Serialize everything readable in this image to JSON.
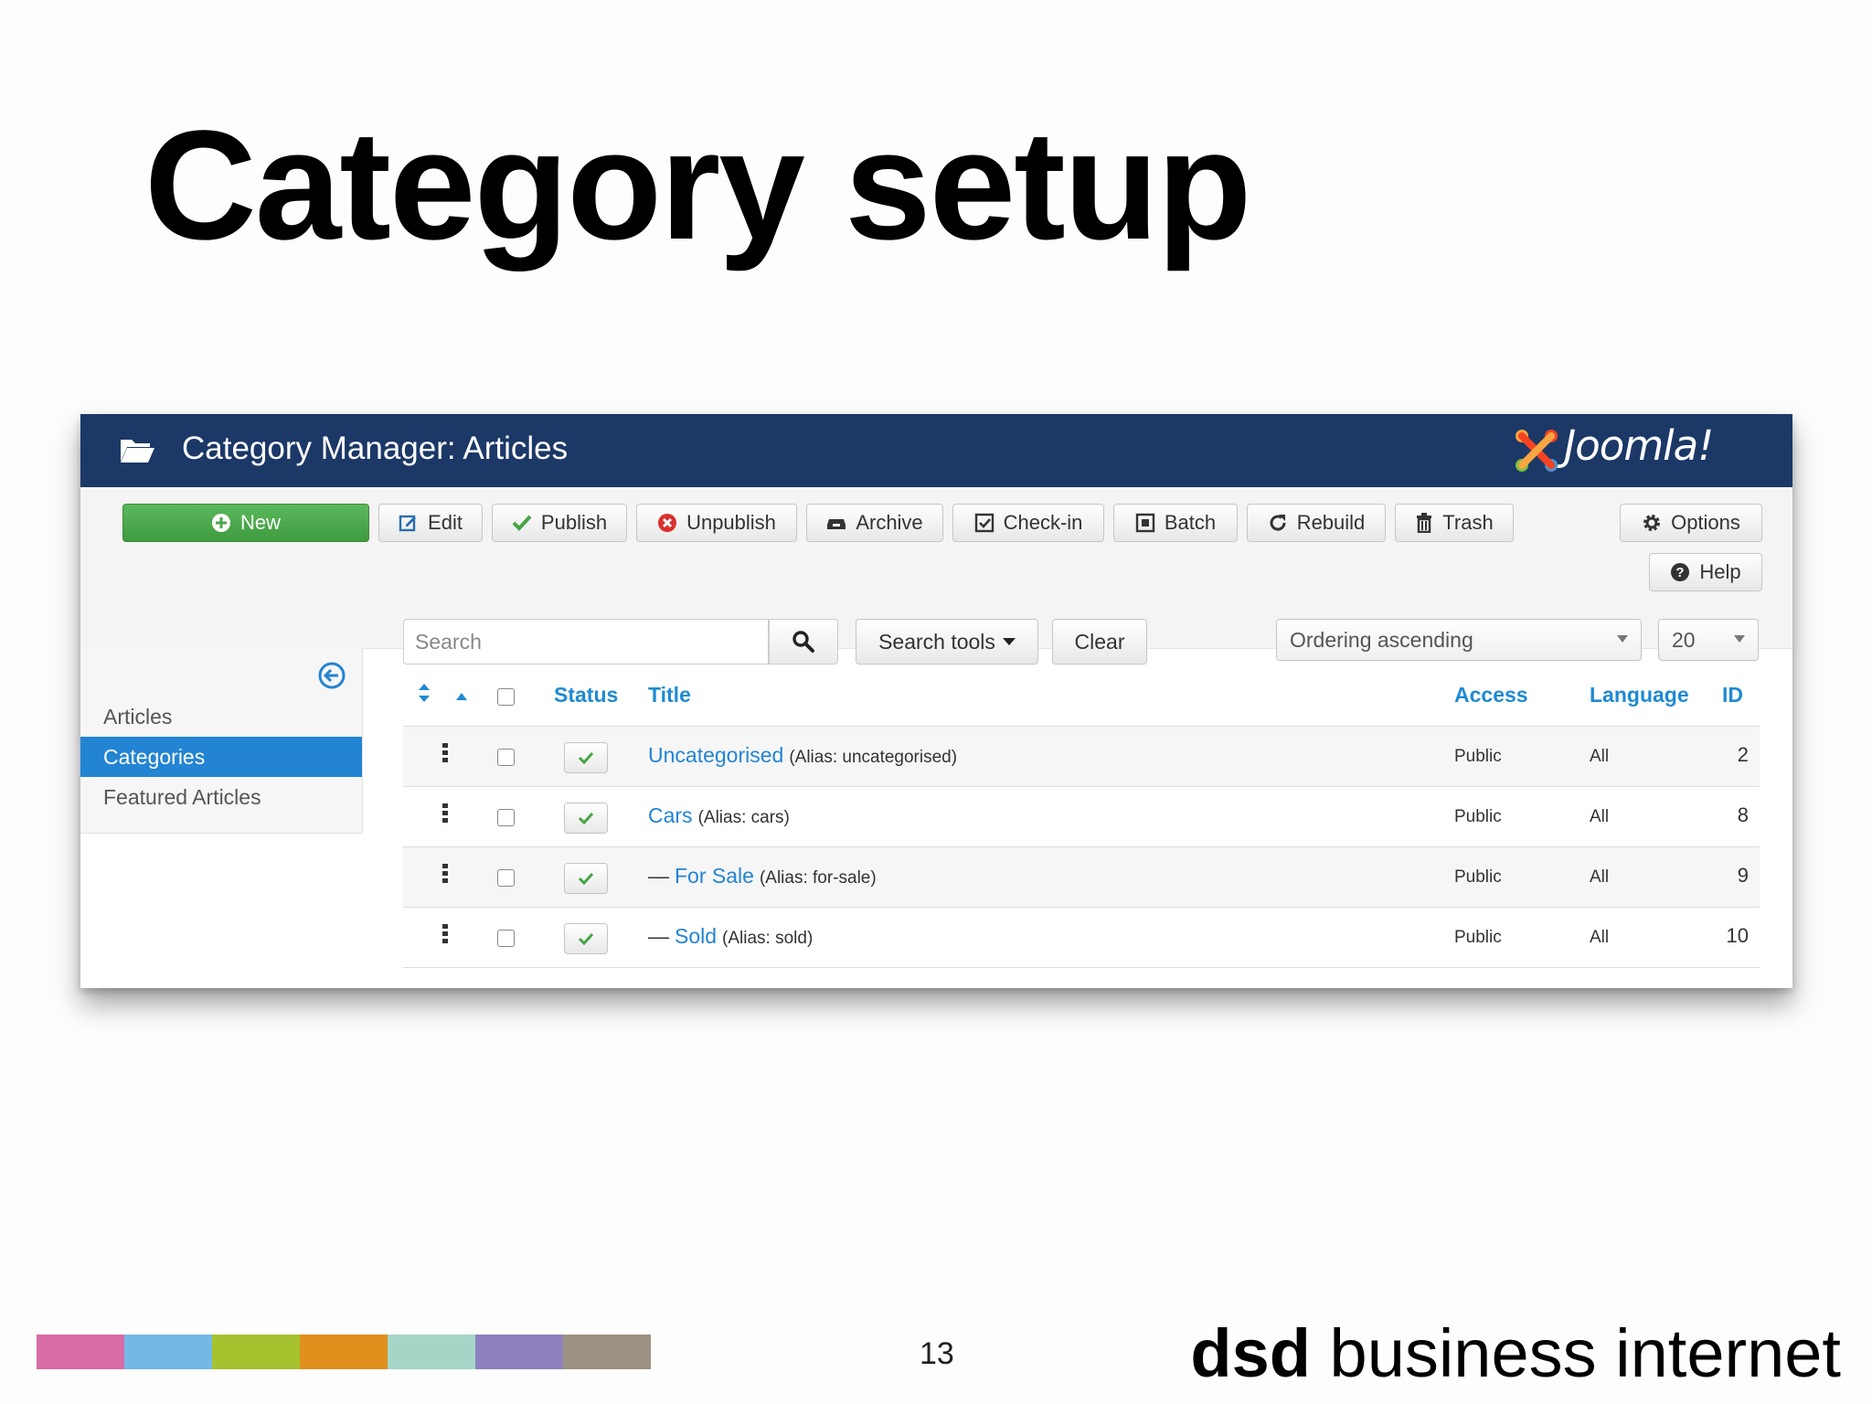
{
  "slide": {
    "title": "Category setup",
    "page_number": "13",
    "brand_bold": "dsd",
    "brand_rest": " business internet",
    "color_strip": [
      "#d86ca6",
      "#74b9e4",
      "#a6c22e",
      "#e08f1d",
      "#a5d5c6",
      "#8e80be",
      "#9c9282"
    ]
  },
  "app": {
    "header_title": "Category Manager: Articles",
    "logo_text": "Joomla!",
    "header_icon": "folder-open-icon",
    "header_bg": "#1b3867",
    "accent": "#2384d3"
  },
  "toolbar": {
    "new": "New",
    "edit": "Edit",
    "publish": "Publish",
    "unpublish": "Unpublish",
    "archive": "Archive",
    "checkin": "Check-in",
    "batch": "Batch",
    "rebuild": "Rebuild",
    "trash": "Trash",
    "options": "Options",
    "help": "Help"
  },
  "sidebar": {
    "items": [
      {
        "label": "Articles",
        "active": false
      },
      {
        "label": "Categories",
        "active": true
      },
      {
        "label": "Featured Articles",
        "active": false
      }
    ]
  },
  "filters": {
    "search_placeholder": "Search",
    "search_tools": "Search tools",
    "clear": "Clear",
    "ordering": "Ordering ascending",
    "limit": "20"
  },
  "table": {
    "columns": {
      "status": "Status",
      "title": "Title",
      "access": "Access",
      "language": "Language",
      "id": "ID"
    },
    "rows": [
      {
        "prefix": "",
        "title": "Uncategorised",
        "alias": "(Alias: uncategorised)",
        "access": "Public",
        "language": "All",
        "id": "2"
      },
      {
        "prefix": "",
        "title": "Cars",
        "alias": "(Alias: cars)",
        "access": "Public",
        "language": "All",
        "id": "8"
      },
      {
        "prefix": "—",
        "title": "For Sale",
        "alias": "(Alias: for-sale)",
        "access": "Public",
        "language": "All",
        "id": "9"
      },
      {
        "prefix": "—",
        "title": "Sold",
        "alias": "(Alias: sold)",
        "access": "Public",
        "language": "All",
        "id": "10"
      }
    ]
  }
}
